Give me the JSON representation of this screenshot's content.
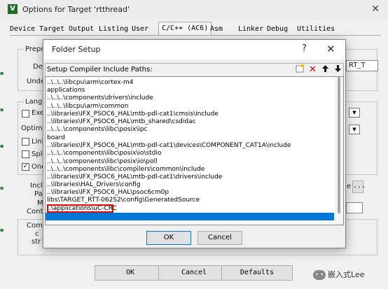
{
  "window": {
    "title": "Options for Target 'rtthread'",
    "close_glyph": "✕",
    "icon_letter": "V"
  },
  "tabs": [
    {
      "label": "Device"
    },
    {
      "label": "Target"
    },
    {
      "label": "Output"
    },
    {
      "label": "Listing"
    },
    {
      "label": "User"
    },
    {
      "label": "C/C++ (AC6)",
      "active": true
    },
    {
      "label": "Asm"
    },
    {
      "label": "Linker"
    },
    {
      "label": "Debug"
    },
    {
      "label": "Utilities"
    }
  ],
  "background_labels": {
    "prepro": "Prepro",
    "def": "Def",
    "undef": "Unde",
    "lang": "Langu",
    "exe": "Exe",
    "optim": "Optimiz",
    "link": "Linl",
    "split": "Spli",
    "one": "One",
    "inclu": "Inclu",
    "pa": "Pa",
    "m": "M",
    "contr": "Contr",
    "comp": "Comp",
    "c": "c",
    "str": "str",
    "right_field": "RT_T",
    "right_e": "e",
    "right_dots": "...",
    "right_r": "r",
    "check_mark": "✓"
  },
  "bottom_buttons": {
    "ok": "OK",
    "cancel": "Cancel",
    "defaults": "Defaults"
  },
  "dialog": {
    "title": "Folder Setup",
    "help": "?",
    "close": "✕",
    "paths_header": "Setup Compiler Include Paths:",
    "toolbar": {
      "new_icon": "new-folder-icon",
      "delete_icon": "delete-icon",
      "up_icon": "move-up-icon",
      "down_icon": "move-down-icon"
    },
    "paths": [
      "..\\..\\..\\libcpu\\arm\\cortex-m4",
      "applications",
      "..\\..\\..\\components\\drivers\\include",
      "..\\..\\..\\libcpu\\arm\\common",
      "..\\libraries\\IFX_PSOC6_HAL\\mtb-pdl-cat1\\cmsis\\include",
      "..\\libraries\\IFX_PSOC6_HAL\\mtb_shared\\csdidac",
      "..\\..\\..\\components\\libc\\posix\\ipc",
      "board",
      "..\\libraries\\IFX_PSOC6_HAL\\mtb-pdl-cat1\\devices\\COMPONENT_CAT1A\\include",
      "..\\..\\..\\components\\libc\\posix\\io\\stdio",
      "..\\..\\..\\components\\libc\\posix\\io\\poll",
      "..\\..\\..\\components\\libc\\compilers\\common\\include",
      "..\\libraries\\IFX_PSOC6_HAL\\mtb-pdl-cat1\\drivers\\include",
      "..\\libraries\\HAL_Drivers\\config",
      "..\\libraries\\IFX_PSOC6_HAL\\psoc6cm0p",
      "libs\\TARGET_RTT-062S2\\config\\GeneratedSource",
      ".\\applications\\uC-CRC"
    ],
    "ok": "OK",
    "cancel": "Cancel"
  },
  "watermark": "嵌入式Lee",
  "colors": {
    "selection": "#0078d7",
    "highlight_box": "#e00000",
    "delete": "#d00000"
  }
}
